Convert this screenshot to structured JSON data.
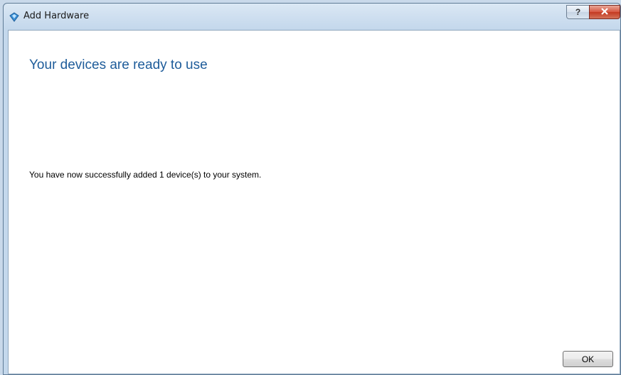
{
  "window": {
    "title": "Add Hardware",
    "help_label": "?",
    "close_icon": "close-icon",
    "title_icon": "hardware-wizard-icon"
  },
  "content": {
    "heading": "Your devices are ready to use",
    "message": "You have now successfully added 1 device(s) to your system."
  },
  "buttons": {
    "ok_label": "OK"
  },
  "colors": {
    "heading": "#1e5c9a",
    "close_button": "#c33a22"
  }
}
